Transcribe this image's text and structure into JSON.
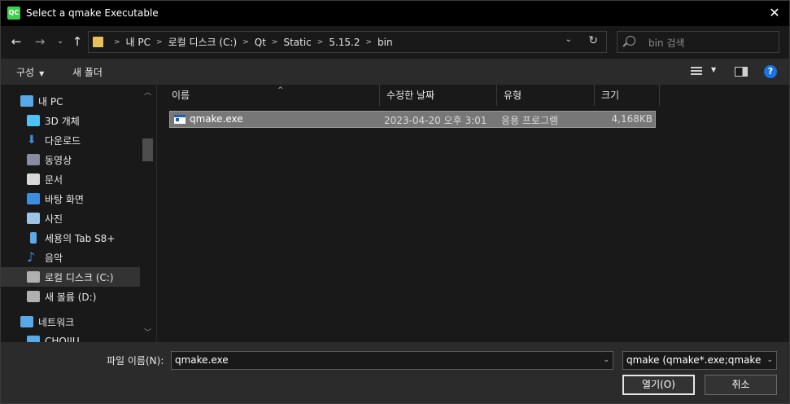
{
  "window": {
    "title": "Select a qmake Executable",
    "logo_text": "QC"
  },
  "address": {
    "crumbs": [
      "내 PC",
      "로컬 디스크 (C:)",
      "Qt",
      "Static",
      "5.15.2",
      "bin"
    ]
  },
  "search": {
    "placeholder": "bin 검색"
  },
  "commands": {
    "organize": "구성",
    "new_folder": "새 폴더"
  },
  "sidebar": {
    "items": [
      {
        "label": "내 PC",
        "icon": "pc-icon",
        "indent": 0
      },
      {
        "label": "3D 개체",
        "icon": "cube-icon",
        "indent": 1
      },
      {
        "label": "다운로드",
        "icon": "download-icon",
        "indent": 1
      },
      {
        "label": "동영상",
        "icon": "video-icon",
        "indent": 1
      },
      {
        "label": "문서",
        "icon": "document-icon",
        "indent": 1
      },
      {
        "label": "바탕 화면",
        "icon": "desktop-icon",
        "indent": 1
      },
      {
        "label": "사진",
        "icon": "pictures-icon",
        "indent": 1
      },
      {
        "label": "세용의 Tab S8+",
        "icon": "tablet-icon",
        "indent": 1
      },
      {
        "label": "음악",
        "icon": "music-icon",
        "indent": 1
      },
      {
        "label": "로컬 디스크 (C:)",
        "icon": "drive-c-icon",
        "indent": 1,
        "selected": true
      },
      {
        "label": "새 볼륨 (D:)",
        "icon": "drive-d-icon",
        "indent": 1
      },
      {
        "label": "네트워크",
        "icon": "network-icon",
        "indent": 0
      },
      {
        "label": "CHOIJU",
        "icon": "computer-icon",
        "indent": 1
      }
    ]
  },
  "columns": {
    "name": "이름",
    "date": "수정한 날짜",
    "type": "유형",
    "size": "크기"
  },
  "files": [
    {
      "name": "qmake.exe",
      "date": "2023-04-20 오후 3:01",
      "type": "응용 프로그램",
      "size": "4,168KB"
    }
  ],
  "footer": {
    "filename_label": "파일 이름(N):",
    "filename_value": "qmake.exe",
    "filter_value": "qmake (qmake*.exe;qmake*.bat)",
    "open_label": "열기(O)",
    "cancel_label": "취소"
  },
  "colors": {
    "accent": "#1a73e8",
    "qt_green": "#41cd52",
    "folder": "#e8c05a",
    "selection": "#777777"
  }
}
